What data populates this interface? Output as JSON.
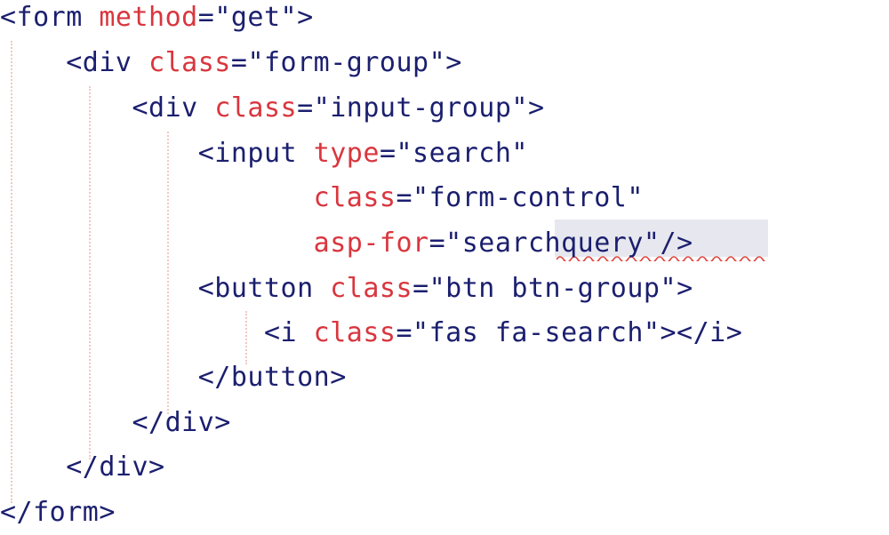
{
  "code": {
    "line1": {
      "tag_open": "<form",
      "attr": "method",
      "eq": "=",
      "val": "\"get\"",
      "close": ">"
    },
    "line2": {
      "tag_open": "<div",
      "attr": "class",
      "eq": "=",
      "val": "\"form-group\"",
      "close": ">"
    },
    "line3": {
      "tag_open": "<div",
      "attr": "class",
      "eq": "=",
      "val": "\"input-group\"",
      "close": ">"
    },
    "line4": {
      "tag_open": "<input",
      "attr": "type",
      "eq": "=",
      "val": "\"search\""
    },
    "line5": {
      "attr": "class",
      "eq": "=",
      "val": "\"form-control\""
    },
    "line6": {
      "attr": "asp-for",
      "eq": "=",
      "quote_open": "\"",
      "val_word": "searchquery",
      "quote_close": "\"",
      "close": "/>"
    },
    "line7": {
      "tag_open": "<button",
      "attr": "class",
      "eq": "=",
      "val": "\"btn btn-group\"",
      "close": ">"
    },
    "line8": {
      "tag_open": "<i",
      "attr": "class",
      "eq": "=",
      "val": "\"fas fa-search\"",
      "close": "></i>"
    },
    "line9": {
      "text": "</button>"
    },
    "line10": {
      "text": "</div>"
    },
    "line11": {
      "text": "</div>"
    },
    "line12": {
      "text": "</form>"
    }
  },
  "colors": {
    "tag": "#1b1f6e",
    "attribute": "#d9363e",
    "value": "#1b1f6e",
    "indent_guide": "#f2c7c7",
    "highlight": "#e7e8ef",
    "spell_squiggle": "#e0413a"
  }
}
